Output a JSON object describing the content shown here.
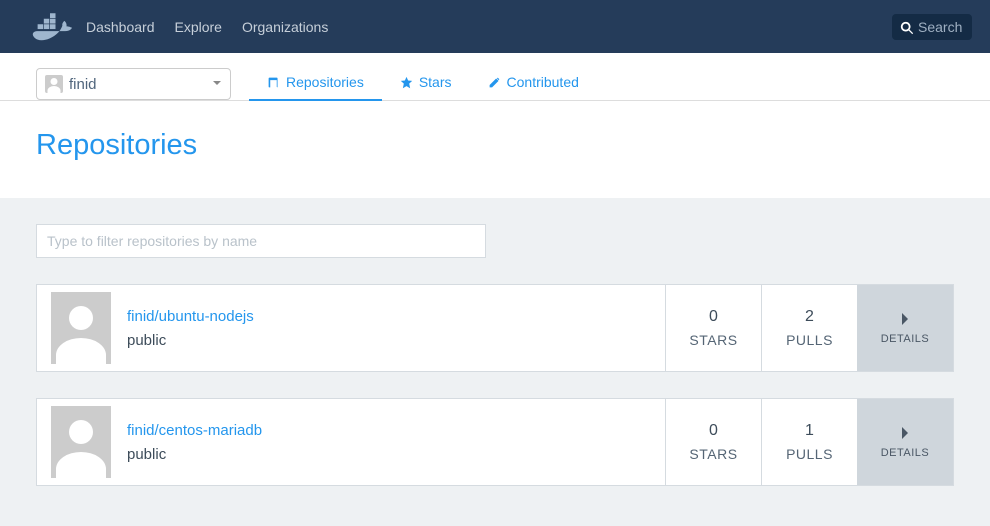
{
  "nav": {
    "links": [
      "Dashboard",
      "Explore",
      "Organizations"
    ],
    "search_placeholder": "Search"
  },
  "user": {
    "name": "finid"
  },
  "tabs": {
    "repositories": "Repositories",
    "stars": "Stars",
    "contributed": "Contributed"
  },
  "page": {
    "title": "Repositories",
    "filter_placeholder": "Type to filter repositories by name",
    "stars_label": "STARS",
    "pulls_label": "PULLS",
    "details_label": "DETAILS"
  },
  "repos": [
    {
      "name": "finid/ubuntu-nodejs",
      "visibility": "public",
      "stars": "0",
      "pulls": "2"
    },
    {
      "name": "finid/centos-mariadb",
      "visibility": "public",
      "stars": "0",
      "pulls": "1"
    }
  ]
}
